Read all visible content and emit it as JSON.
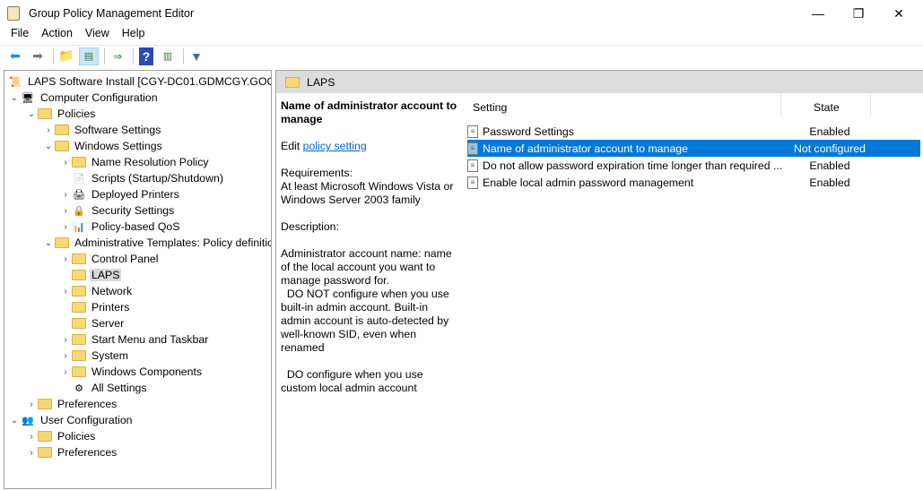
{
  "window": {
    "title": "Group Policy Management Editor",
    "minimize": "—",
    "maximize": "❐",
    "close": "✕"
  },
  "menu": [
    "File",
    "Action",
    "View",
    "Help"
  ],
  "tree": [
    {
      "label": "LAPS Software Install [CGY-DC01.GDMCGY.GOODD",
      "level": 0,
      "chev": "",
      "icon": "gpo"
    },
    {
      "label": "Computer Configuration",
      "level": 1,
      "chev": "⌄",
      "icon": "computer"
    },
    {
      "label": "Policies",
      "level": 2,
      "chev": "⌄",
      "icon": "folder"
    },
    {
      "label": "Software Settings",
      "level": 3,
      "chev": "›",
      "icon": "folder"
    },
    {
      "label": "Windows Settings",
      "level": 3,
      "chev": "⌄",
      "icon": "folder"
    },
    {
      "label": "Name Resolution Policy",
      "level": 4,
      "chev": "›",
      "icon": "folder"
    },
    {
      "label": "Scripts (Startup/Shutdown)",
      "level": 4,
      "chev": "",
      "icon": "script"
    },
    {
      "label": "Deployed Printers",
      "level": 4,
      "chev": "›",
      "icon": "printer"
    },
    {
      "label": "Security Settings",
      "level": 4,
      "chev": "›",
      "icon": "security"
    },
    {
      "label": "Policy-based QoS",
      "level": 4,
      "chev": "›",
      "icon": "chart"
    },
    {
      "label": "Administrative Templates: Policy definitio",
      "level": 3,
      "chev": "⌄",
      "icon": "folder"
    },
    {
      "label": "Control Panel",
      "level": 4,
      "chev": "›",
      "icon": "folder"
    },
    {
      "label": "LAPS",
      "level": 4,
      "chev": "",
      "icon": "folder",
      "selected": true
    },
    {
      "label": "Network",
      "level": 4,
      "chev": "›",
      "icon": "folder"
    },
    {
      "label": "Printers",
      "level": 4,
      "chev": "",
      "icon": "folder"
    },
    {
      "label": "Server",
      "level": 4,
      "chev": "",
      "icon": "folder"
    },
    {
      "label": "Start Menu and Taskbar",
      "level": 4,
      "chev": "›",
      "icon": "folder"
    },
    {
      "label": "System",
      "level": 4,
      "chev": "›",
      "icon": "folder"
    },
    {
      "label": "Windows Components",
      "level": 4,
      "chev": "›",
      "icon": "folder"
    },
    {
      "label": "All Settings",
      "level": 4,
      "chev": "",
      "icon": "allsettings"
    },
    {
      "label": "Preferences",
      "level": 2,
      "chev": "›",
      "icon": "folder"
    },
    {
      "label": "User Configuration",
      "level": 1,
      "chev": "⌄",
      "icon": "users"
    },
    {
      "label": "Policies",
      "level": 2,
      "chev": "›",
      "icon": "folder"
    },
    {
      "label": "Preferences",
      "level": 2,
      "chev": "›",
      "icon": "folder"
    }
  ],
  "header": {
    "title": "LAPS"
  },
  "description": {
    "title": "Name of administrator account to manage",
    "edit_prefix": "Edit ",
    "edit_link": "policy setting",
    "requirements_label": "Requirements:",
    "requirements": "At least Microsoft Windows Vista or Windows Server 2003 family",
    "description_label": "Description:",
    "paragraph1": "Administrator account name: name of the local account you want to manage password for.",
    "paragraph2": "  DO NOT configure when you use built-in admin account. Built-in admin account is auto-detected by well-known SID, even when renamed",
    "paragraph3": "  DO configure when you use custom local admin account"
  },
  "list": {
    "columns": {
      "setting": "Setting",
      "state": "State"
    },
    "rows": [
      {
        "setting": "Password Settings",
        "state": "Enabled"
      },
      {
        "setting": "Name of administrator account to manage",
        "state": "Not configured",
        "selected": true
      },
      {
        "setting": "Do not allow password expiration time longer than required ...",
        "state": "Enabled"
      },
      {
        "setting": "Enable local admin password management",
        "state": "Enabled"
      }
    ]
  },
  "colors": {
    "selection": "#0078d7",
    "header": "#dcdcdc",
    "link": "#0066cc"
  }
}
